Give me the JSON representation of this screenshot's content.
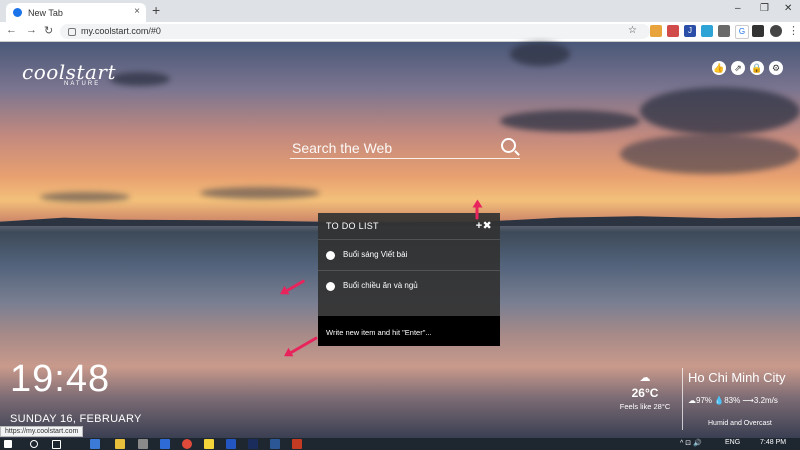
{
  "browser": {
    "tab_title": "New Tab",
    "tab_close": "×",
    "new_tab": "+",
    "win_min": "–",
    "win_max": "❐",
    "win_close": "✕",
    "url": "my.coolstart.com/#0",
    "back": "←",
    "forward": "→",
    "reload": "↻",
    "star": "☆",
    "ext_labels": [
      "J",
      "G"
    ]
  },
  "logo": {
    "main": "coolstart",
    "sub": "NATURE"
  },
  "top_icons": [
    "👍",
    "⇗",
    "🔒",
    "⚙"
  ],
  "search": {
    "placeholder": "Search the Web"
  },
  "todo": {
    "title": "TO DO LIST",
    "add": "+",
    "close": "✖",
    "items": [
      "Buổi sáng Viết bài",
      "Buổi chiều ăn và ngủ"
    ],
    "input_placeholder": "Write new item and hit \"Enter\"..."
  },
  "clock": {
    "time": "19:48",
    "date": "SUNDAY 16, FEBRUARY"
  },
  "status_url": "https://my.coolstart.com",
  "weather": {
    "icon": "☁",
    "temp": "26°C",
    "feels": "Feels like 28°C",
    "city": "Ho Chi Minh City",
    "stats": "☁97%  💧83%  ⟶3.2m/s",
    "condition": "Humid and Overcast"
  },
  "taskbar": {
    "lang": "ENG",
    "time": "7:48 PM",
    "tray_icons": "^ ⊡ 🔊"
  }
}
